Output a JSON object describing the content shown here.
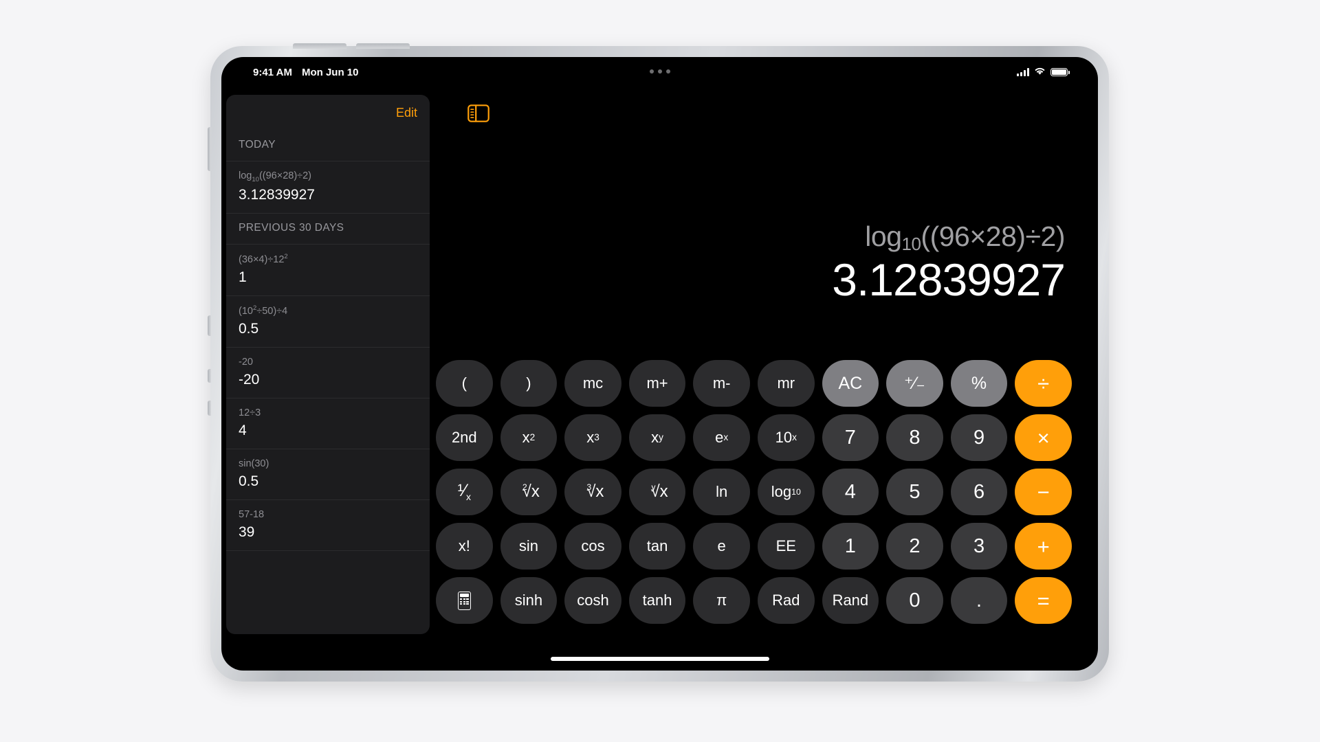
{
  "statusbar": {
    "time": "9:41 AM",
    "date": "Mon Jun 10",
    "signal_icon": "cellular-signal-icon",
    "wifi_icon": "wifi-icon",
    "battery_icon": "battery-icon"
  },
  "multitask": {
    "icon": "multitasking-dots-icon"
  },
  "sidebar": {
    "edit_label": "Edit",
    "toggle_icon": "sidebar-toggle-icon",
    "sections": [
      {
        "title": "TODAY",
        "items": [
          {
            "expr_html": "log<sub>10</sub>((96×28)÷2)",
            "expr_text": "log10((96×28)÷2)",
            "value": "3.12839927"
          }
        ]
      },
      {
        "title": "PREVIOUS 30 DAYS",
        "items": [
          {
            "expr_html": "(36×4)÷12<sup>2</sup>",
            "expr_text": "(36×4)÷12²",
            "value": "1"
          },
          {
            "expr_html": "(10<sup>2</sup>÷50)÷4",
            "expr_text": "(10²÷50)÷4",
            "value": "0.5"
          },
          {
            "expr_html": "-20",
            "expr_text": "-20",
            "value": "-20"
          },
          {
            "expr_html": "12÷3",
            "expr_text": "12÷3",
            "value": "4"
          },
          {
            "expr_html": "sin(30)",
            "expr_text": "sin(30)",
            "value": "0.5"
          },
          {
            "expr_html": "57-18",
            "expr_text": "57-18",
            "value": "39"
          }
        ]
      }
    ]
  },
  "display": {
    "expression_html": "log<sub>10</sub>((96×28)÷2)",
    "expression_text": "log10((96×28)÷2)",
    "result": "3.12839927"
  },
  "keypad": {
    "rows": [
      [
        {
          "name": "open-paren",
          "label": "(",
          "style": "fn"
        },
        {
          "name": "close-paren",
          "label": ")",
          "style": "fn"
        },
        {
          "name": "memory-clear",
          "label": "mc",
          "style": "fn"
        },
        {
          "name": "memory-add",
          "label": "m+",
          "style": "fn"
        },
        {
          "name": "memory-subtract",
          "label": "m-",
          "style": "fn"
        },
        {
          "name": "memory-recall",
          "label": "mr",
          "style": "fn"
        },
        {
          "name": "all-clear",
          "label": "AC",
          "style": "fnlight"
        },
        {
          "name": "sign-toggle",
          "label": "⁺⁄₋",
          "style": "fnlight"
        },
        {
          "name": "percent",
          "label": "%",
          "style": "fnlight"
        },
        {
          "name": "divide",
          "label": "÷",
          "style": "op"
        }
      ],
      [
        {
          "name": "second-function",
          "label": "2nd",
          "style": "fn"
        },
        {
          "name": "x-squared",
          "label_html": "x<sup>2</sup>",
          "label": "x²",
          "style": "fn"
        },
        {
          "name": "x-cubed",
          "label_html": "x<sup>3</sup>",
          "label": "x³",
          "style": "fn"
        },
        {
          "name": "x-to-the-y",
          "label_html": "x<sup>y</sup>",
          "label": "x^y",
          "style": "fn"
        },
        {
          "name": "e-to-the-x",
          "label_html": "e<sup>x</sup>",
          "label": "e^x",
          "style": "fn"
        },
        {
          "name": "ten-to-the-x",
          "label_html": "10<sup>x</sup>",
          "label": "10^x",
          "style": "fn"
        },
        {
          "name": "digit-7",
          "label": "7",
          "style": "num"
        },
        {
          "name": "digit-8",
          "label": "8",
          "style": "num"
        },
        {
          "name": "digit-9",
          "label": "9",
          "style": "num"
        },
        {
          "name": "multiply",
          "label": "×",
          "style": "op"
        }
      ],
      [
        {
          "name": "reciprocal",
          "label": "⅟ₓ",
          "label_html": "<span class=\"frac\">¹⁄<sub>x</sub></span>",
          "style": "fn"
        },
        {
          "name": "square-root",
          "label": "²√x",
          "label_html": "<span class=\"radic\"><span class=\"idx\">2</span><span class=\"rt\">√x</span></span>",
          "style": "fn"
        },
        {
          "name": "cube-root",
          "label": "³√x",
          "label_html": "<span class=\"radic\"><span class=\"idx\">3</span><span class=\"rt\">√x</span></span>",
          "style": "fn"
        },
        {
          "name": "y-root",
          "label": "ʸ√x",
          "label_html": "<span class=\"radic\"><span class=\"idx\">y</span><span class=\"rt\">√x</span></span>",
          "style": "fn"
        },
        {
          "name": "natural-log",
          "label": "ln",
          "style": "fn"
        },
        {
          "name": "log-base-10",
          "label": "log10",
          "label_html": "log<sub>10</sub>",
          "style": "fn"
        },
        {
          "name": "digit-4",
          "label": "4",
          "style": "num"
        },
        {
          "name": "digit-5",
          "label": "5",
          "style": "num"
        },
        {
          "name": "digit-6",
          "label": "6",
          "style": "num"
        },
        {
          "name": "subtract",
          "label": "−",
          "style": "op"
        }
      ],
      [
        {
          "name": "factorial",
          "label": "x!",
          "style": "fn"
        },
        {
          "name": "sine",
          "label": "sin",
          "style": "fn"
        },
        {
          "name": "cosine",
          "label": "cos",
          "style": "fn"
        },
        {
          "name": "tangent",
          "label": "tan",
          "style": "fn"
        },
        {
          "name": "euler-number",
          "label": "e",
          "style": "fn"
        },
        {
          "name": "exponent-entry",
          "label": "EE",
          "style": "fn"
        },
        {
          "name": "digit-1",
          "label": "1",
          "style": "num"
        },
        {
          "name": "digit-2",
          "label": "2",
          "style": "num"
        },
        {
          "name": "digit-3",
          "label": "3",
          "style": "num"
        },
        {
          "name": "add",
          "label": "+",
          "style": "op"
        }
      ],
      [
        {
          "name": "basic-calculator-icon",
          "label": "",
          "style": "fn",
          "icon": "calculator-icon"
        },
        {
          "name": "hyperbolic-sine",
          "label": "sinh",
          "style": "fn"
        },
        {
          "name": "hyperbolic-cosine",
          "label": "cosh",
          "style": "fn"
        },
        {
          "name": "hyperbolic-tangent",
          "label": "tanh",
          "style": "fn"
        },
        {
          "name": "pi",
          "label": "π",
          "style": "fn"
        },
        {
          "name": "radians-mode",
          "label": "Rad",
          "style": "fn"
        },
        {
          "name": "random",
          "label": "Rand",
          "style": "fn"
        },
        {
          "name": "digit-0",
          "label": "0",
          "style": "num"
        },
        {
          "name": "decimal-point",
          "label": ".",
          "style": "num"
        },
        {
          "name": "equals",
          "label": "=",
          "style": "op"
        }
      ]
    ]
  },
  "colors": {
    "accent": "#ff9f0a",
    "key_function": "#2c2c2e",
    "key_number": "#3a3a3c",
    "key_light": "#7f7f83",
    "sidebar_bg": "#1c1c1e",
    "screen_bg": "#000000"
  }
}
